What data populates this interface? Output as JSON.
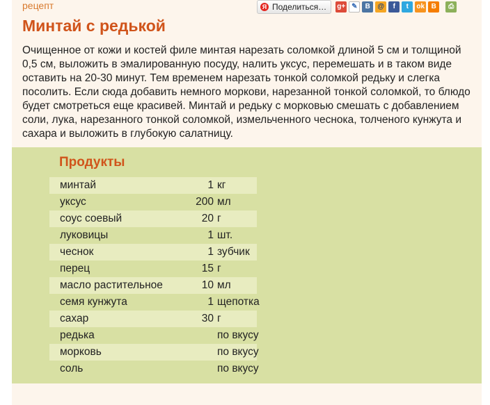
{
  "category": "рецепт",
  "share": {
    "button_label": "Поделиться…",
    "icons": [
      "google-plus-icon",
      "bookmark-icon",
      "vk-icon",
      "mail-icon",
      "facebook-icon",
      "twitter-icon",
      "odnoklassniki-icon",
      "blogger-icon"
    ]
  },
  "recipe": {
    "title": "Минтай с редькой",
    "description": "Очищенное от кожи и костей филе минтая нарезать соломкой длиной 5 см и толщиной 0,5 см, выложить в эмалированную посуду, налить уксус, перемешать и в таком виде оставить на 20-30 минут. Тем временем нарезать тонкой соломкой редьку и слегка посолить. Если сюда добавить немного моркови, нарезанной тонкой соломкой, то блюдо будет смотреться еще красивей. Минтай и редьку с морковью смешать с добавлением соли, лука, нарезанного тонкой соломкой, измельченного чеснока, толченого кунжута и сахара и выложить в глубокую салатницу."
  },
  "ingredients": {
    "title": "Продукты",
    "items": [
      {
        "name": "минтай",
        "qty": "1",
        "unit": "кг"
      },
      {
        "name": "уксус",
        "qty": "200",
        "unit": "мл"
      },
      {
        "name": "соус соевый",
        "qty": "20",
        "unit": "г"
      },
      {
        "name": "луковицы",
        "qty": "1",
        "unit": "шт."
      },
      {
        "name": "чеснок",
        "qty": "1",
        "unit": "зубчик"
      },
      {
        "name": "перец",
        "qty": "15",
        "unit": "г"
      },
      {
        "name": "масло растительное",
        "qty": "10",
        "unit": "мл"
      },
      {
        "name": "семя кунжута",
        "qty": "1",
        "unit": "щепотка"
      },
      {
        "name": "сахар",
        "qty": "30",
        "unit": "г"
      },
      {
        "name": "редька",
        "qty": "",
        "unit": "по вкусу"
      },
      {
        "name": "морковь",
        "qty": "",
        "unit": "по вкусу"
      },
      {
        "name": "соль",
        "qty": "",
        "unit": "по вкусу"
      }
    ]
  }
}
